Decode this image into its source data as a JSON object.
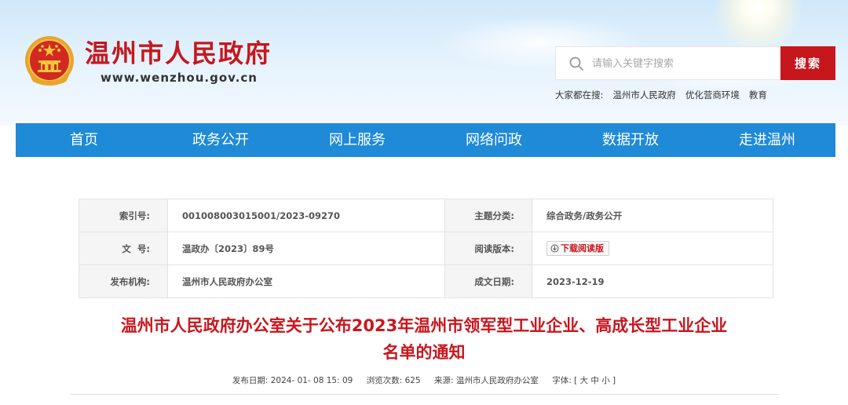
{
  "header": {
    "site_title": "温州市人民政府",
    "site_url": "www.wenzhou.gov.cn"
  },
  "search": {
    "placeholder": "请输入关键字搜索",
    "button_label": "搜索",
    "hot_label": "大家都在搜:",
    "hot_links": [
      "温州市人民政府",
      "优化营商环境",
      "教育"
    ]
  },
  "nav": {
    "items": [
      "首页",
      "政务公开",
      "网上服务",
      "网络问政",
      "数据开放",
      "走进温州"
    ]
  },
  "meta_table": {
    "index_label": "索引号:",
    "index_value": "001008003015001/2023-09270",
    "category_label": "主题分类:",
    "category_value": "综合政务/政务公开",
    "doc_no_label": "文  号:",
    "doc_no_value": "温政办〔2023〕89号",
    "reading_label": "阅读版本:",
    "download_label": "下载阅读版",
    "publisher_label": "发布机构:",
    "publisher_value": "温州市人民政府办公室",
    "date_label": "成文日期:",
    "date_value": "2023-12-19"
  },
  "article": {
    "title_line1": "温州市人民政府办公室关于公布2023年温州市领军型工业企业、高成长型工业企业",
    "title_line2": "名单的通知",
    "publish_label": "发布日期:",
    "publish_value": "2024- 01- 08 15: 09",
    "views_label": "浏览次数:",
    "views_value": "625",
    "source_label": "来源:",
    "source_value": "温州市人民政府办公室",
    "font_label": "字体:",
    "font_control": "[ 大 中 小 ]"
  },
  "colors": {
    "brand_red": "#c8161d",
    "nav_blue": "#1e8ad8"
  },
  "icons": [
    "national-emblem-icon",
    "search-icon",
    "download-icon"
  ]
}
